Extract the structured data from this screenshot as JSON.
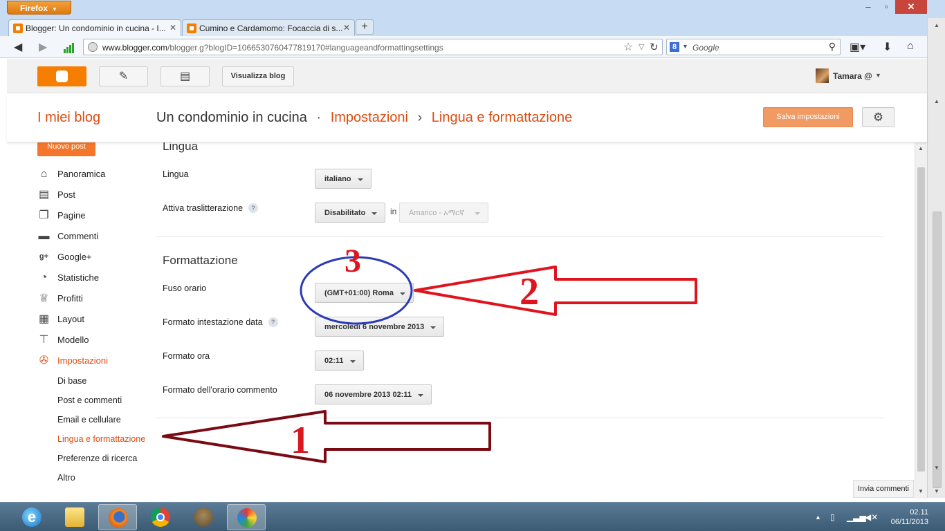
{
  "browser": {
    "menu_button": "Firefox",
    "tabs": [
      {
        "title": "Blogger: Un condominio in cucina - I..."
      },
      {
        "title": "Cumino e Cardamomo: Focaccia di s..."
      }
    ],
    "url_host": "www.blogger.com",
    "url_rest": "/blogger.g?blogID=1066530760477819170#languageandformattingsettings",
    "search_placeholder": "Google",
    "search_engine_icon": "8"
  },
  "blogger": {
    "view_blog": "Visualizza blog",
    "user_name": "Tamara @",
    "my_blogs": "I miei blog",
    "breadcrumb": {
      "blog": "Un condominio in cucina",
      "dot": "·",
      "section": "Impostazioni",
      "sep": "›",
      "page": "Lingua e formattazione"
    },
    "save_settings": "Salva impostazioni",
    "new_post": "Nuovo post",
    "sidebar": [
      {
        "label": "Panoramica",
        "icon": "home-icon"
      },
      {
        "label": "Post",
        "icon": "posts-icon"
      },
      {
        "label": "Pagine",
        "icon": "pages-icon"
      },
      {
        "label": "Commenti",
        "icon": "comments-icon"
      },
      {
        "label": "Google+",
        "icon": "google-plus-icon"
      },
      {
        "label": "Statistiche",
        "icon": "stats-icon"
      },
      {
        "label": "Profitti",
        "icon": "trophy-icon"
      },
      {
        "label": "Layout",
        "icon": "layout-icon"
      },
      {
        "label": "Modello",
        "icon": "template-icon"
      },
      {
        "label": "Impostazioni",
        "icon": "wrench-icon"
      }
    ],
    "settings_sub": [
      {
        "label": "Di base"
      },
      {
        "label": "Post e commenti"
      },
      {
        "label": "Email e cellulare"
      },
      {
        "label": "Lingua e formattazione"
      },
      {
        "label": "Preferenze di ricerca"
      },
      {
        "label": "Altro"
      }
    ],
    "language_section": {
      "title": "Lingua",
      "language_label": "Lingua",
      "language_value": "italiano",
      "translit_label": "Attiva traslitterazione",
      "translit_value": "Disabilitato",
      "in_label": "in",
      "translit_lang": "Amarico - አማርኛ"
    },
    "formatting_section": {
      "title": "Formattazione",
      "timezone_label": "Fuso orario",
      "timezone_value": "(GMT+01:00) Roma",
      "date_header_label": "Formato intestazione data",
      "date_header_value": "mercoledì 6 novembre 2013",
      "time_label": "Formato ora",
      "time_value": "02:11",
      "comment_time_label": "Formato dell'orario commento",
      "comment_time_value": "06 novembre 2013 02:11"
    },
    "feedback": "Invia commenti",
    "help_glyph": "?"
  },
  "annotations": {
    "arrow1_number": "1",
    "arrow2_number": "2",
    "circle_number": "3",
    "colors": {
      "arrow1": "#7a0a12",
      "arrow2": "#e0141e",
      "circle": "#2b3bb5",
      "number1": "#d81820"
    }
  },
  "taskbar": {
    "time": "02.11",
    "date": "06/11/2013"
  }
}
